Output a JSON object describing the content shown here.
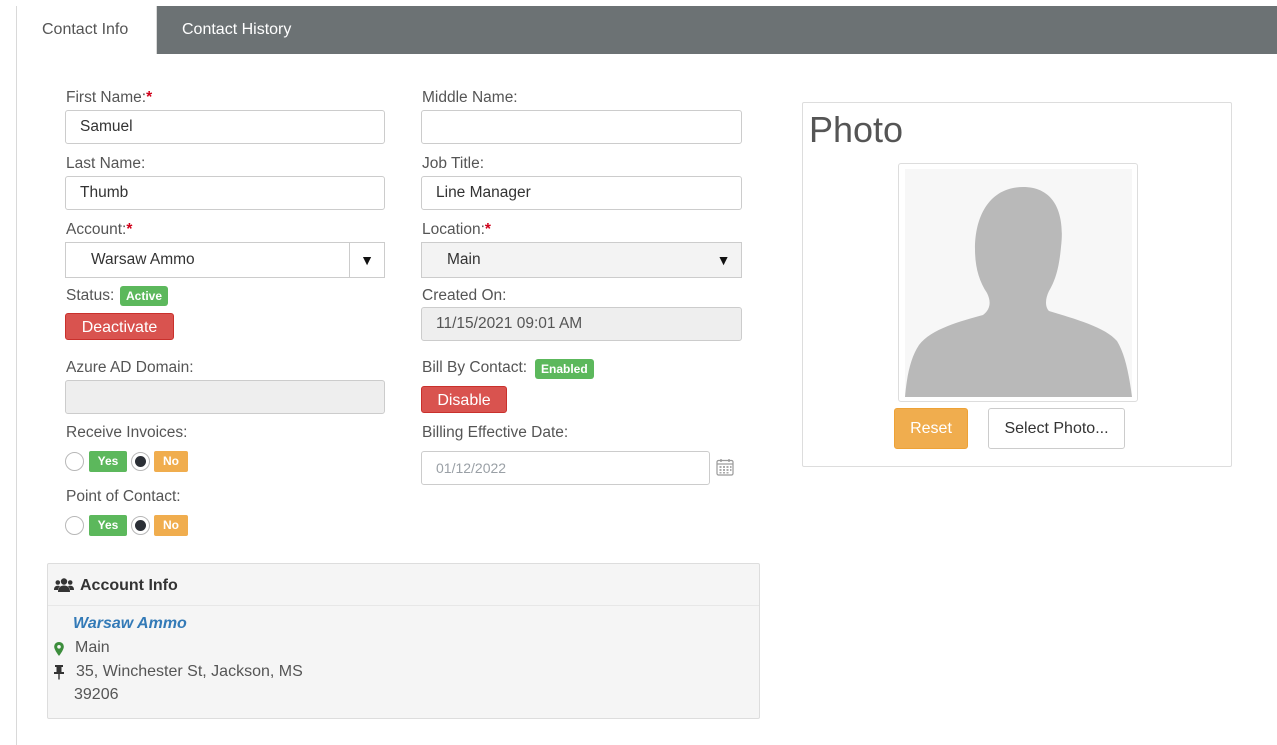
{
  "tabs": [
    {
      "label": "Contact Info",
      "active": true
    },
    {
      "label": "Contact History",
      "active": false
    }
  ],
  "form": {
    "first_name": {
      "label": "First Name:",
      "required_mark": "*",
      "value": "Samuel"
    },
    "middle_name": {
      "label": "Middle Name:",
      "value": ""
    },
    "last_name": {
      "label": "Last Name:",
      "value": "Thumb"
    },
    "job_title": {
      "label": "Job Title:",
      "value": "Line Manager"
    },
    "account": {
      "label": "Account:",
      "required_mark": "*",
      "value": "Warsaw Ammo"
    },
    "location": {
      "label": "Location:",
      "required_mark": "*",
      "value": "Main"
    },
    "status": {
      "label": "Status:",
      "badge": "Active",
      "button": "Deactivate"
    },
    "created_on": {
      "label": "Created On:",
      "value": "11/15/2021 09:01 AM"
    },
    "azure_ad_domain": {
      "label": "Azure AD Domain:",
      "value": ""
    },
    "bill_by_contact": {
      "label": "Bill By Contact:",
      "badge": "Enabled",
      "button": "Disable"
    },
    "receive_invoices": {
      "label": "Receive Invoices:",
      "yes": "Yes",
      "no": "No",
      "selected": "No"
    },
    "billing_effective_date": {
      "label": "Billing Effective Date:",
      "value": "01/12/2022"
    },
    "point_of_contact": {
      "label": "Point of Contact:",
      "yes": "Yes",
      "no": "No",
      "selected": "No"
    }
  },
  "photo": {
    "title": "Photo",
    "reset_label": "Reset",
    "select_label": "Select Photo..."
  },
  "account_info": {
    "title": "Account Info",
    "name": "Warsaw Ammo",
    "location": "Main",
    "address_line1": "35, Winchester St, Jackson, MS",
    "address_line2": "39206"
  },
  "colors": {
    "tabbar": "#6c7274",
    "danger": "#d9534f",
    "success": "#5cb85c",
    "warning": "#f0ad4e",
    "link": "#337ab7",
    "required": "#d0021b"
  }
}
